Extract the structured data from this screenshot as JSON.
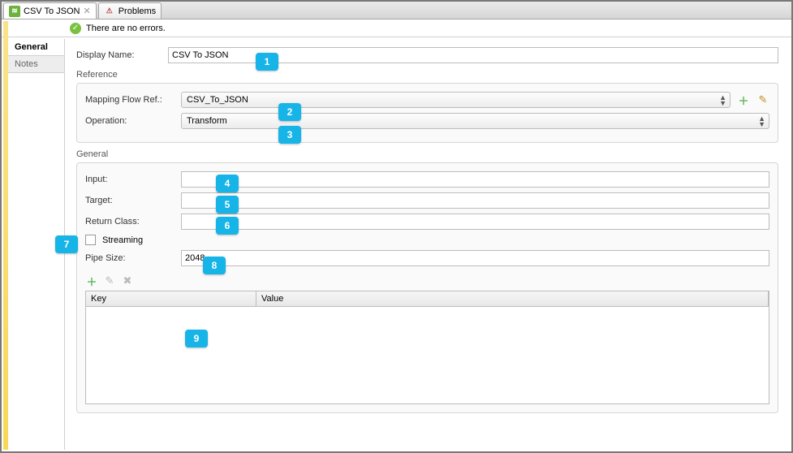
{
  "tabs": [
    {
      "label": "CSV To JSON",
      "icon": "flow-icon"
    },
    {
      "label": "Problems",
      "icon": "problems-icon"
    }
  ],
  "status": {
    "message": "There are no errors."
  },
  "sideTabs": [
    {
      "label": "General"
    },
    {
      "label": "Notes"
    }
  ],
  "display": {
    "nameLabel": "Display Name:",
    "nameValue": "CSV To JSON"
  },
  "reference": {
    "title": "Reference",
    "mappingLabel": "Mapping Flow Ref.:",
    "mappingValue": "CSV_To_JSON",
    "operationLabel": "Operation:",
    "operationValue": "Transform"
  },
  "general": {
    "title": "General",
    "inputLabel": "Input:",
    "inputValue": "",
    "targetLabel": "Target:",
    "targetValue": "",
    "returnLabel": "Return Class:",
    "returnValue": "",
    "streamingLabel": "Streaming",
    "pipeLabel": "Pipe Size:",
    "pipeValue": "2048",
    "keyHeader": "Key",
    "valueHeader": "Value"
  },
  "callouts": {
    "c1": "1",
    "c2": "2",
    "c3": "3",
    "c4": "4",
    "c5": "5",
    "c6": "6",
    "c7": "7",
    "c8": "8",
    "c9": "9"
  }
}
